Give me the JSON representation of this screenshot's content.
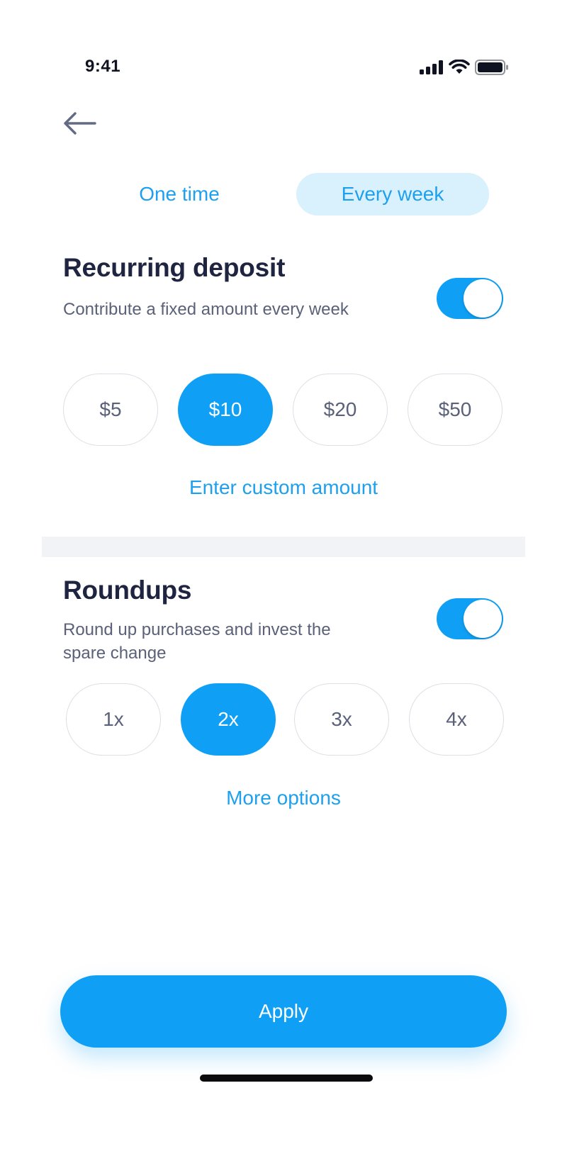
{
  "status_bar": {
    "time": "9:41",
    "icons": [
      "cellular-signal-icon",
      "wifi-icon",
      "battery-icon"
    ]
  },
  "nav": {
    "back_icon": "arrow-left-icon"
  },
  "frequency_tabs": {
    "one_time": "One time",
    "every_week": "Every week",
    "selected": "every_week"
  },
  "recurring": {
    "title": "Recurring deposit",
    "description": "Contribute a fixed amount every week",
    "toggle_on": true,
    "amounts": [
      "$5",
      "$10",
      "$20",
      "$50"
    ],
    "selected_amount": "$10",
    "custom_link": "Enter custom amount"
  },
  "roundups": {
    "title": "Roundups",
    "description_line1": "Round up purchases and invest the",
    "description_line2": "spare change",
    "toggle_on": true,
    "multipliers": [
      "1x",
      "2x",
      "3x",
      "4x"
    ],
    "selected_multiplier": "2x",
    "more_link": "More options"
  },
  "footer": {
    "apply_label": "Apply"
  },
  "colors": {
    "accent": "#0fa0f5",
    "accent_light": "#d9f0fd",
    "text_dark": "#1f2541",
    "text_muted": "#5a6178",
    "pill_border": "#dcdfe6",
    "divider": "#f2f3f7"
  }
}
